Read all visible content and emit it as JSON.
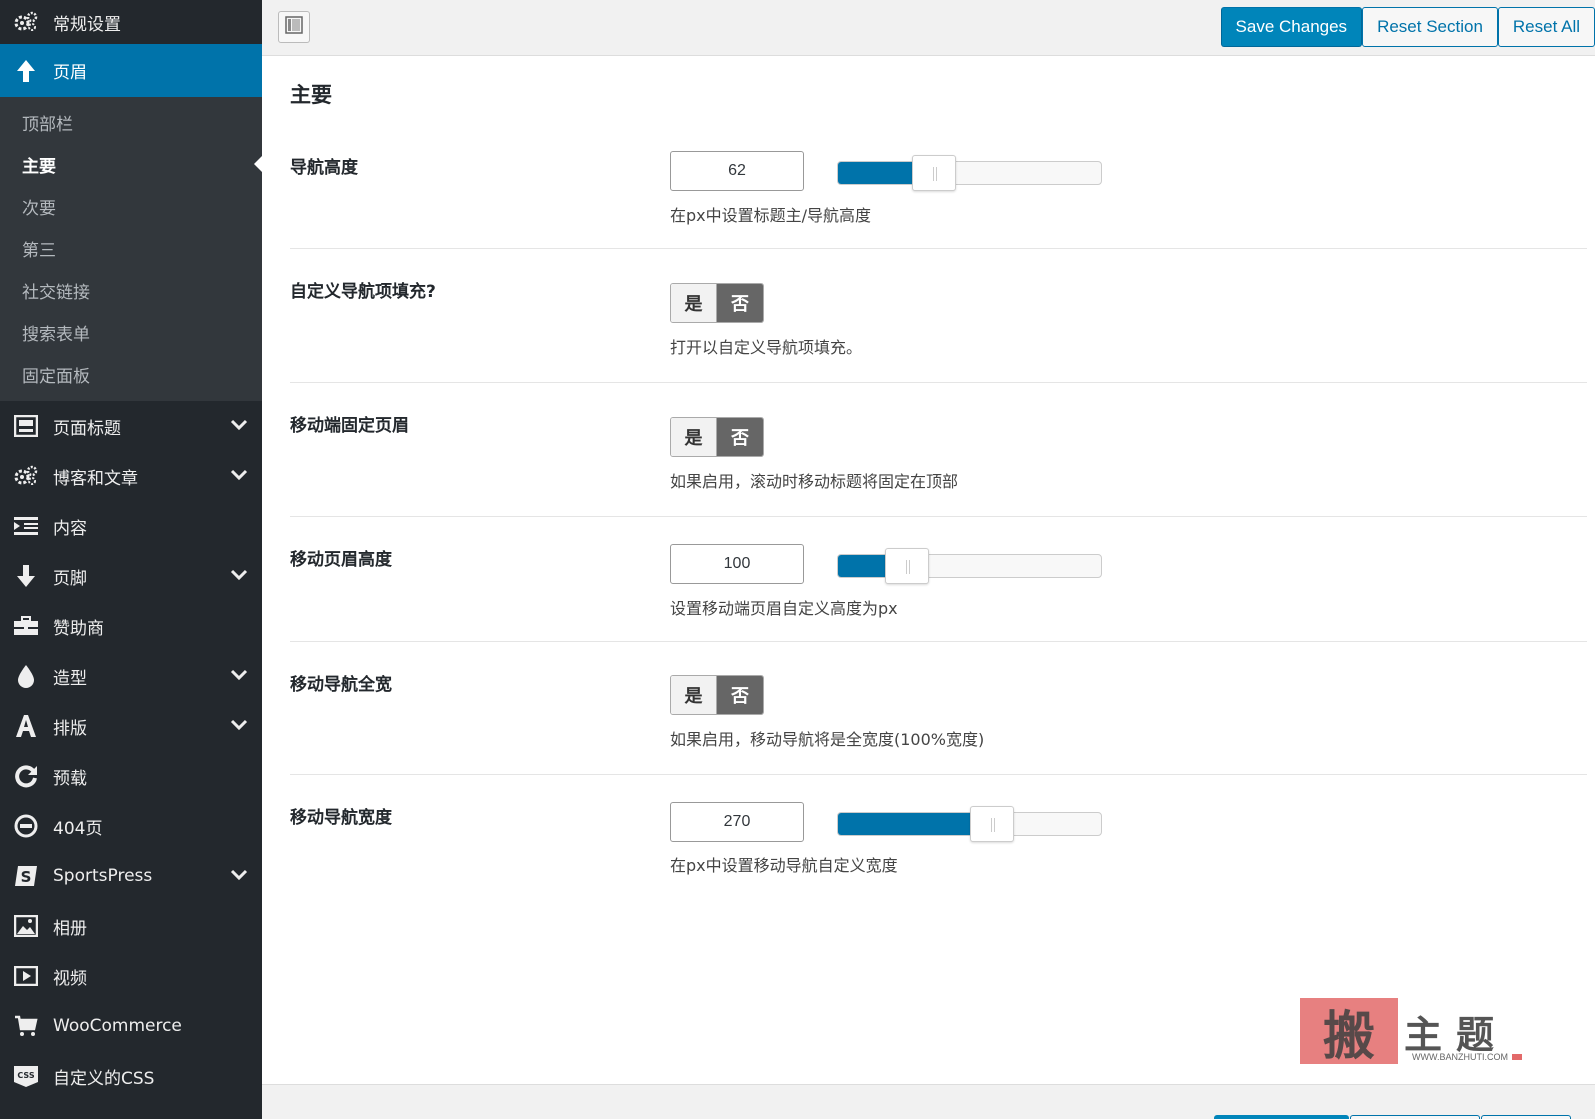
{
  "sidebar": {
    "items_top": [
      {
        "label": "常规设置",
        "icon": "gears-icon"
      },
      {
        "label": "页眉",
        "icon": "arrow-up-icon",
        "active": true
      }
    ],
    "subitems": [
      "顶部栏",
      "主要",
      "次要",
      "第三",
      "社交链接",
      "搜索表单",
      "固定面板"
    ],
    "current_sub": "主要",
    "items": [
      {
        "label": "页面标题",
        "icon": "page-title-icon",
        "has_children": true
      },
      {
        "label": "博客和文章",
        "icon": "gears-icon",
        "has_children": true
      },
      {
        "label": "内容",
        "icon": "content-icon",
        "has_children": false
      },
      {
        "label": "页脚",
        "icon": "arrow-down-icon",
        "has_children": true
      },
      {
        "label": "赞助商",
        "icon": "briefcase-icon",
        "has_children": false
      },
      {
        "label": "造型",
        "icon": "drop-icon",
        "has_children": true
      },
      {
        "label": "排版",
        "icon": "font-icon",
        "has_children": true
      },
      {
        "label": "预载",
        "icon": "refresh-icon",
        "has_children": false
      },
      {
        "label": "404页",
        "icon": "minus-circle-icon",
        "has_children": false
      },
      {
        "label": "SportsPress",
        "icon": "sportspress-icon",
        "has_children": true
      },
      {
        "label": "相册",
        "icon": "image-icon",
        "has_children": false
      },
      {
        "label": "视频",
        "icon": "video-icon",
        "has_children": false
      },
      {
        "label": "WooCommerce",
        "icon": "cart-icon",
        "has_children": false
      },
      {
        "label": "自定义的CSS",
        "icon": "css-icon",
        "has_children": false
      }
    ]
  },
  "toolbar": {
    "save_label": "Save Changes",
    "reset_section_label": "Reset Section",
    "reset_all_label": "Reset All"
  },
  "section": {
    "title": "主要",
    "fields": [
      {
        "type": "slider",
        "label": "导航高度",
        "value": "62",
        "fill": 0.28,
        "desc": "在px中设置标题主/导航高度"
      },
      {
        "type": "switch",
        "label": "自定义导航项填充?",
        "on": "是",
        "off": "否",
        "selected": "否",
        "desc": "打开以自定义导航项填充。"
      },
      {
        "type": "switch",
        "label": "移动端固定页眉",
        "on": "是",
        "off": "否",
        "selected": "否",
        "desc": "如果启用，滚动时移动标题将固定在顶部"
      },
      {
        "type": "slider",
        "label": "移动页眉高度",
        "value": "100",
        "fill": 0.18,
        "desc": "设置移动端页眉自定义高度为px"
      },
      {
        "type": "switch",
        "label": "移动导航全宽",
        "on": "是",
        "off": "否",
        "selected": "否",
        "desc": "如果启用，移动导航将是全宽度(100%宽度)"
      },
      {
        "type": "slider",
        "label": "移动导航宽度",
        "value": "270",
        "fill": 0.5,
        "desc": "在px中设置移动导航自定义宽度"
      }
    ]
  },
  "watermark": {
    "text": "主题",
    "stamp": "搬",
    "url": "WWW.BANZHUTI.COM"
  },
  "colors": {
    "sidebar_bg": "#23282d",
    "accent": "#0073aa",
    "primary_button": "#0085ba"
  }
}
